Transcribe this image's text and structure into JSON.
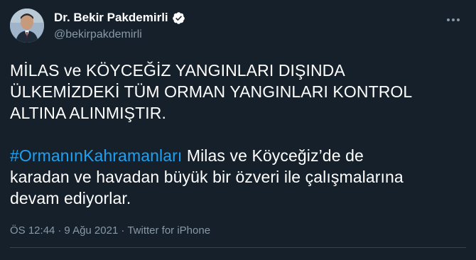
{
  "author": {
    "display_name": "Dr. Bekir Pakdemirli",
    "handle": "@bekirpakdemirli",
    "verified": true
  },
  "tweet": {
    "lines_paragraph1": [
      "MİLAS ve KÖYCEĞİZ YANGINLARI DIŞINDA",
      "ÜLKEMİZDEKİ TÜM ORMAN YANGINLARI KONTROL",
      "ALTINA ALINMIŞTIR."
    ],
    "hashtag": "#OrmanınKahramanları",
    "paragraph2_line1_rest": " Milas ve Köyceğiz’de de",
    "paragraph2_line2": "karadan ve havadan büyük bir özveri ile çalışmalarına",
    "paragraph2_line3": "devam ediyorlar."
  },
  "meta": {
    "time": "ÖS 12:44",
    "separator": "·",
    "date": "9 Ağu 2021",
    "source": "Twitter for iPhone"
  },
  "icons": {
    "verified": "verified-badge-icon",
    "more": "more-options-icon"
  },
  "colors": {
    "background": "#15202b",
    "link": "#1da1f2",
    "secondary_text": "#8899a6"
  }
}
